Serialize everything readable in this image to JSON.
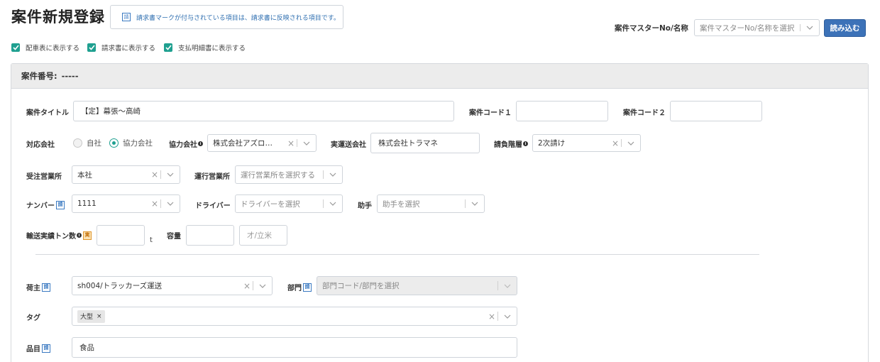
{
  "page": {
    "title": "案件新規登録",
    "notice_badge": "請",
    "notice_text": "請求書マークが付与されている項目は、請求書に反映される項目です。"
  },
  "master": {
    "label": "案件マスターNo/名称",
    "placeholder": "案件マスターNo/名称を選択",
    "load_button": "読み込む"
  },
  "checkboxes": [
    {
      "label": "配車表に表示する",
      "checked": true
    },
    {
      "label": "請求書に表示する",
      "checked": true
    },
    {
      "label": "支払明細書に表示する",
      "checked": true
    }
  ],
  "panel": {
    "case_number_label": "案件番号:",
    "case_number_value": "-----"
  },
  "form": {
    "title_label": "案件タイトル",
    "title_value": "【定】幕張〜高崎",
    "code1_label": "案件コード１",
    "code1_value": "",
    "code2_label": "案件コード２",
    "code2_value": "",
    "company_label": "対応会社",
    "company_options": [
      "自社",
      "協力会社"
    ],
    "company_selected": "協力会社",
    "partner_label": "協力会社",
    "partner_value": "株式会社アズロ…",
    "actual_label": "実運送会社",
    "actual_value": "株式会社トラマネ",
    "tier_label": "請負階層",
    "tier_value": "2次請け",
    "order_office_label": "受注営業所",
    "order_office_value": "本社",
    "op_office_label": "運行営業所",
    "op_office_placeholder": "運行営業所を選択する",
    "number_label": "ナンバー",
    "number_value": "1111",
    "driver_label": "ドライバー",
    "driver_placeholder": "ドライバーを選択",
    "assistant_label": "助手",
    "assistant_placeholder": "助手を選択",
    "tonnage_label": "輸送実績トン数",
    "tonnage_unit": "t",
    "capacity_label": "容量",
    "capacity_placeholder": "才/立米",
    "shipper_label": "荷主",
    "shipper_value": "sh004/トラッカーズ運送",
    "dept_label": "部門",
    "dept_placeholder": "部門コード/部門を選択",
    "tag_label": "タグ",
    "tags": [
      "大型"
    ],
    "item_label": "品目",
    "item_value": "食品"
  },
  "badges": {
    "invoice": "請",
    "actual": "実",
    "info": "i"
  },
  "colors": {
    "accent_teal": "#1fa090",
    "primary_button": "#3c72b8",
    "notice_text": "#2f6fb0"
  }
}
